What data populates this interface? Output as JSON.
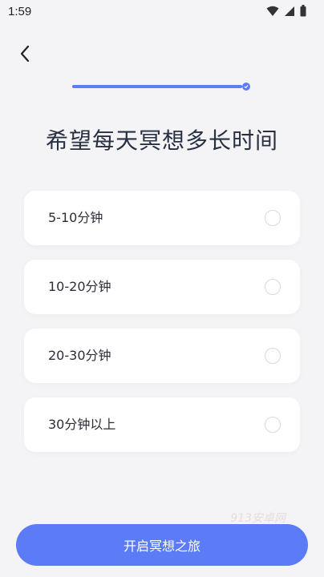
{
  "status_bar": {
    "time": "1:59",
    "icons": [
      "wifi-icon",
      "cell-signal-icon",
      "battery-icon"
    ]
  },
  "nav": {
    "back_icon": "chevron-left-icon"
  },
  "progress": {
    "value_fraction": 1.0,
    "accent_color": "#5b7cf6"
  },
  "question": {
    "title": "希望每天冥想多长时间"
  },
  "options": [
    {
      "label": "5-10分钟",
      "selected": false
    },
    {
      "label": "10-20分钟",
      "selected": false
    },
    {
      "label": "20-30分钟",
      "selected": false
    },
    {
      "label": "30分钟以上",
      "selected": false
    }
  ],
  "watermark": "913安卓网",
  "cta": {
    "label": "开启冥想之旅",
    "color": "#5b7cf6"
  }
}
